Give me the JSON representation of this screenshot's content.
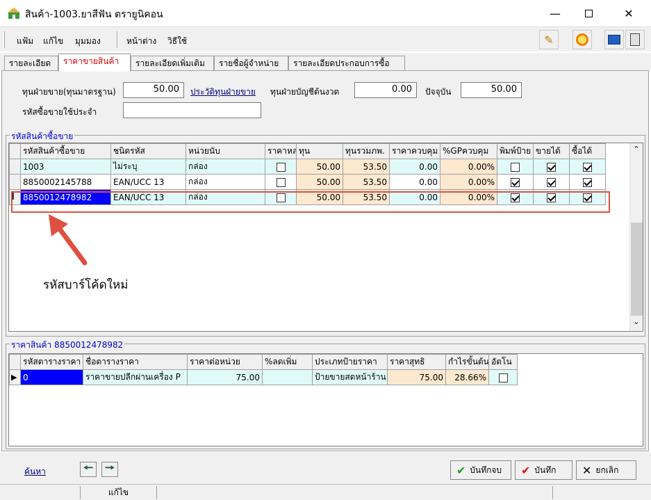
{
  "window": {
    "title": "สินค้า-1003.ยาสีฟัน ตรายูนิคอน"
  },
  "menu": {
    "items": [
      "แฟ้ม",
      "แก้ไข",
      "มุมมอง",
      "หน้าต่าง",
      "วิธีใช้"
    ]
  },
  "tabs": [
    "รายละเอียด",
    "ราคาขายสินค้า",
    "รายละเอียดเพิ่มเติม",
    "รายชื่อผู้จำหน่าย",
    "รายละเอียดประกอบการซื้อ"
  ],
  "cost": {
    "std_label": "ทุนฝ่ายขาย(ทุนมาตรฐาน)",
    "std_value": "50.00",
    "history_link": "ประวัติทุนฝ่ายขาย",
    "acct_label": "ทุนฝ่ายบัญชีต้นงวด",
    "acct_value": "0.00",
    "current_label": "ปัจจุบัน",
    "current_value": "50.00",
    "default_code_label": "รหัสซื้อขายใช้ประจำ",
    "default_code_value": ""
  },
  "barcode_grid": {
    "group_title": "รหัสสินค้าซื้อขาย",
    "headers": [
      "รหัสสินค้าซื้อขาย",
      "ชนิดรหัส",
      "หน่วยนับ",
      "ราคาหล",
      "ทุน",
      "ทุนรวมภพ.",
      "ราคาควบคุม",
      "%GPควบคุม",
      "พิมพ์ป้าย",
      "ขายได้",
      "ซื้อได้"
    ],
    "rows": [
      {
        "code": "1003",
        "type": "ไม่ระบุ",
        "unit": "กล่อง",
        "main": false,
        "cost": "50.00",
        "cost_vat": "53.50",
        "ctrl_price": "0.00",
        "gp": "0.00%",
        "print": false,
        "sell": true,
        "buy": true
      },
      {
        "code": "8850002145788",
        "type": "EAN/UCC 13",
        "unit": "กล่อง",
        "main": false,
        "cost": "50.00",
        "cost_vat": "53.50",
        "ctrl_price": "0.00",
        "gp": "0.00%",
        "print": true,
        "sell": true,
        "buy": true
      },
      {
        "code": "8850012478982",
        "type": "EAN/UCC 13",
        "unit": "กล่อง",
        "main": false,
        "cost": "50.00",
        "cost_vat": "53.50",
        "ctrl_price": "0.00",
        "gp": "0.00%",
        "print": true,
        "sell": true,
        "buy": true
      }
    ],
    "annotation": "รหัสบาร์โค้ดใหม่"
  },
  "price_grid": {
    "group_title": "ราคาสินค้า 8850012478982",
    "headers": [
      "รหัสตารางราคา",
      "ชื่อตารางราคา",
      "ราคาต่อหน่วย",
      "%ลดเพิ่ม",
      "ประเภทป้ายราคา",
      "ราคาสุทธิ",
      "กำไรขั้นต้น",
      "อัตโน"
    ],
    "rows": [
      {
        "code": "0",
        "name": "ราคาขายปลีกผ่านเครื่อง P",
        "unit_price": "75.00",
        "discount": "",
        "label_type": "ป้ายขายสดหน้าร้าน",
        "net": "75.00",
        "margin": "28.66%",
        "auto": false
      }
    ]
  },
  "bottom": {
    "search": "ค้นหา",
    "save_close": "บันทึกจบ",
    "save": "บันทึก",
    "cancel": "ยกเลิก"
  },
  "status": {
    "mode": "แก้ไข"
  },
  "colors": {
    "accent_red": "#e00000",
    "selection": "#0000ff",
    "annotation": "#e05040"
  }
}
